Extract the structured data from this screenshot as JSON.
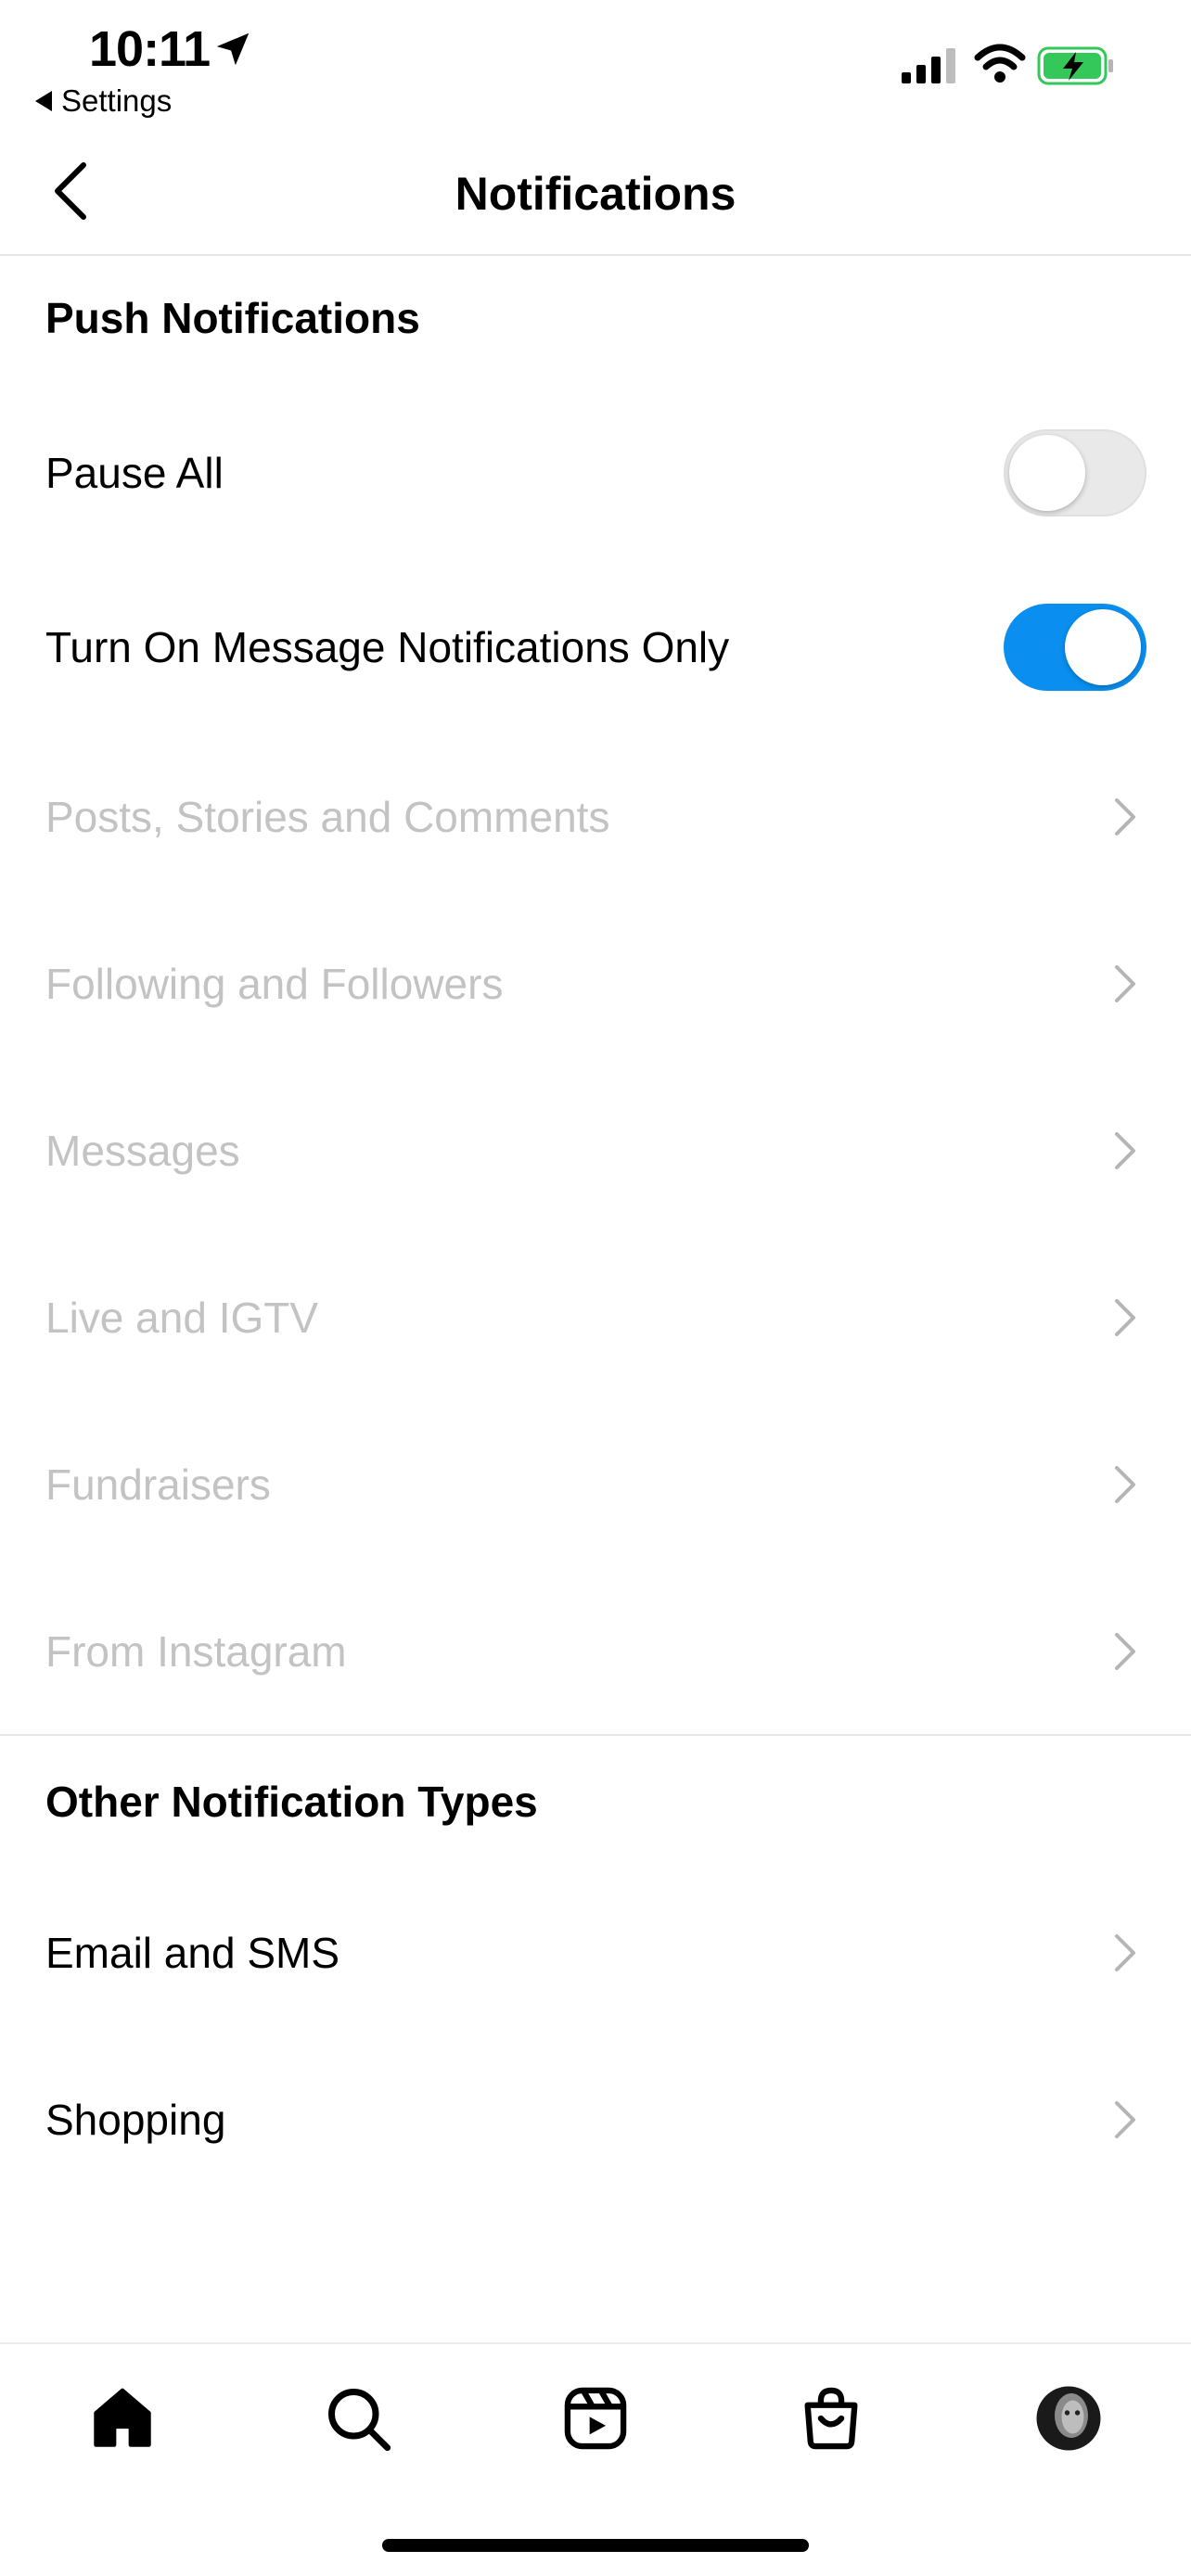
{
  "status_bar": {
    "time": "10:11",
    "back_app_label": "Settings",
    "battery_color": "#34c759"
  },
  "header": {
    "title": "Notifications"
  },
  "push_section": {
    "title": "Push Notifications",
    "pause_all": {
      "label": "Pause All",
      "on": false
    },
    "message_only": {
      "label": "Turn On Message Notifications Only",
      "on": true
    },
    "items": [
      {
        "label": "Posts, Stories and Comments"
      },
      {
        "label": "Following and Followers"
      },
      {
        "label": "Messages"
      },
      {
        "label": "Live and IGTV"
      },
      {
        "label": "Fundraisers"
      },
      {
        "label": "From Instagram"
      }
    ]
  },
  "other_section": {
    "title": "Other Notification Types",
    "items": [
      {
        "label": "Email and SMS"
      },
      {
        "label": "Shopping"
      }
    ]
  },
  "tabbar": {
    "tabs": [
      {
        "icon": "home-icon"
      },
      {
        "icon": "search-icon"
      },
      {
        "icon": "reels-icon"
      },
      {
        "icon": "shop-icon"
      },
      {
        "icon": "profile-avatar"
      }
    ]
  },
  "colors": {
    "accent": "#0a8ff0",
    "disabled_text": "#c3c3c3",
    "divider": "#e6e6e6"
  }
}
